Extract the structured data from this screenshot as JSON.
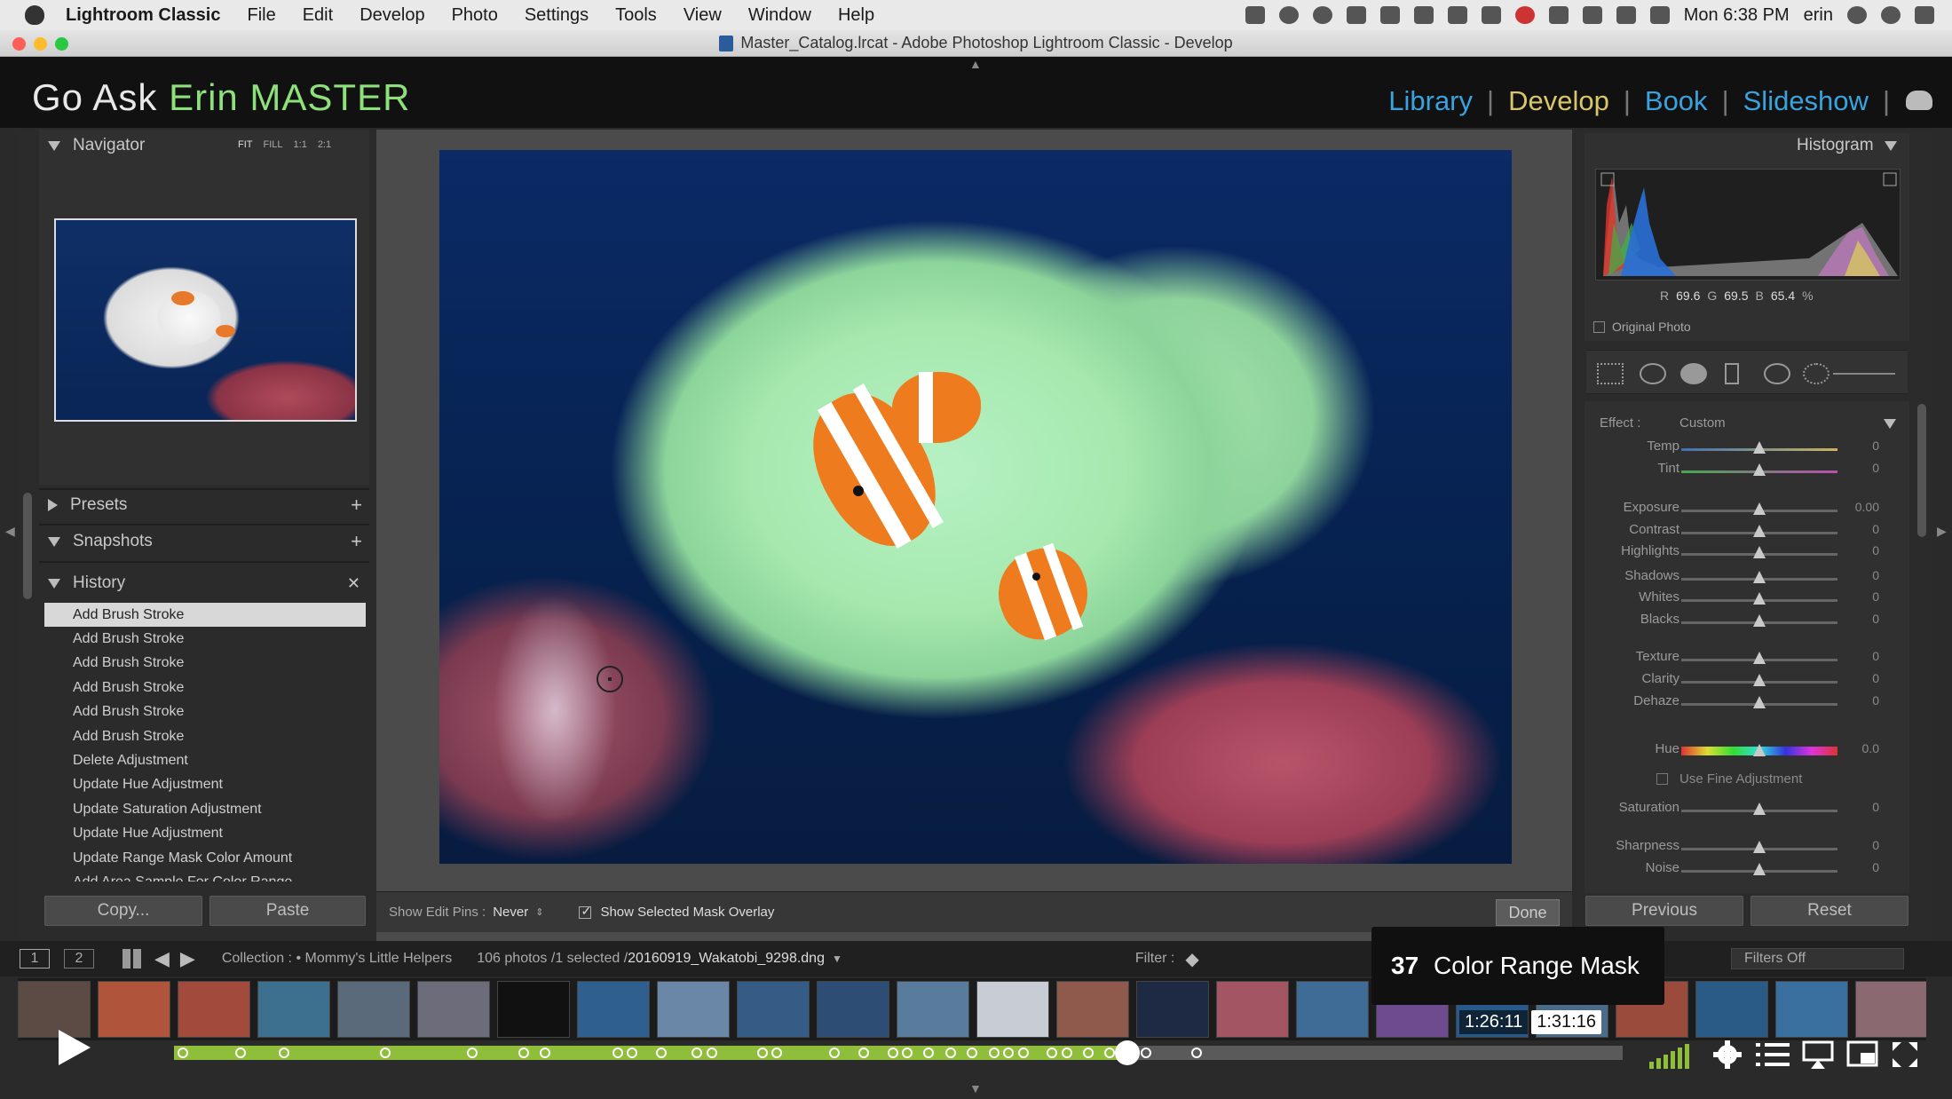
{
  "menubar": {
    "items": [
      "Lightroom Classic",
      "File",
      "Edit",
      "Develop",
      "Photo",
      "Settings",
      "Tools",
      "View",
      "Window",
      "Help"
    ],
    "clock": "Mon 6:38 PM",
    "user": "erin"
  },
  "window": {
    "title": "Master_Catalog.lrcat - Adobe Photoshop Lightroom Classic - Develop"
  },
  "identity": {
    "part1": "Go Ask ",
    "part2": "Erin MASTER"
  },
  "modules": [
    "Library",
    "Develop",
    "Book",
    "Slideshow"
  ],
  "left": {
    "navigator": "Navigator",
    "zoom": [
      "FIT",
      "FILL",
      "1:1",
      "2:1"
    ],
    "presets": "Presets",
    "snapshots": "Snapshots",
    "history": "History",
    "history_items": [
      "Add Brush Stroke",
      "Add Brush Stroke",
      "Add Brush Stroke",
      "Add Brush Stroke",
      "Add Brush Stroke",
      "Add Brush Stroke",
      "Delete Adjustment",
      "Update Hue Adjustment",
      "Update Saturation Adjustment",
      "Update Hue Adjustment",
      "Update Range Mask Color Amount",
      "Add Area Sample For Color Range"
    ],
    "copy_btn": "Copy...",
    "paste_btn": "Paste"
  },
  "toolbar": {
    "edit_pins_label": "Show Edit Pins :",
    "edit_pins_value": "Never",
    "mask_overlay": "Show Selected Mask Overlay",
    "done": "Done"
  },
  "right": {
    "histogram": "Histogram",
    "r_label": "R",
    "r": "69.6",
    "g_label": "G",
    "g": "69.5",
    "b_label": "B",
    "b": "65.4",
    "pct": "%",
    "original_photo": "Original Photo",
    "effect_label": "Effect :",
    "effect_value": "Custom",
    "sliders": [
      {
        "label": "Temp",
        "value": "0",
        "pos": 0.5
      },
      {
        "label": "Tint",
        "value": "0",
        "pos": 0.5
      },
      {
        "label": "Exposure",
        "value": "0.00",
        "pos": 0.5
      },
      {
        "label": "Contrast",
        "value": "0",
        "pos": 0.5
      },
      {
        "label": "Highlights",
        "value": "0",
        "pos": 0.5
      },
      {
        "label": "Shadows",
        "value": "0",
        "pos": 0.5
      },
      {
        "label": "Whites",
        "value": "0",
        "pos": 0.5
      },
      {
        "label": "Blacks",
        "value": "0",
        "pos": 0.5
      },
      {
        "label": "Texture",
        "value": "0",
        "pos": 0.5
      },
      {
        "label": "Clarity",
        "value": "0",
        "pos": 0.5
      },
      {
        "label": "Dehaze",
        "value": "0",
        "pos": 0.5
      },
      {
        "label": "Hue",
        "value": "0.0",
        "pos": 0.5
      },
      {
        "label": "Saturation",
        "value": "0",
        "pos": 0.5
      },
      {
        "label": "Sharpness",
        "value": "0",
        "pos": 0.5
      },
      {
        "label": "Noise",
        "value": "0",
        "pos": 0.5
      }
    ],
    "fine_adjust": "Use Fine Adjustment",
    "previous": "Previous",
    "reset": "Reset"
  },
  "filmstrip": {
    "page1": "1",
    "page2": "2",
    "collection": "Collection : • Mommy's Little Helpers",
    "count": "106 photos /1 selected /",
    "filename": "20160919_Wakatobi_9298.dng",
    "filter_label": "Filter :",
    "filter_value": "Filters Off"
  },
  "video": {
    "chapter_num": "37",
    "chapter_title": "Color Range Mask",
    "time_current": "1:26:11",
    "time_hover": "1:31:16",
    "progress": 0.658
  },
  "colors": {
    "module_link": "#3aa2dd",
    "module_active": "#d9c66a",
    "plate_accent": "#8ee07a",
    "progress": "#8fbe3a"
  }
}
